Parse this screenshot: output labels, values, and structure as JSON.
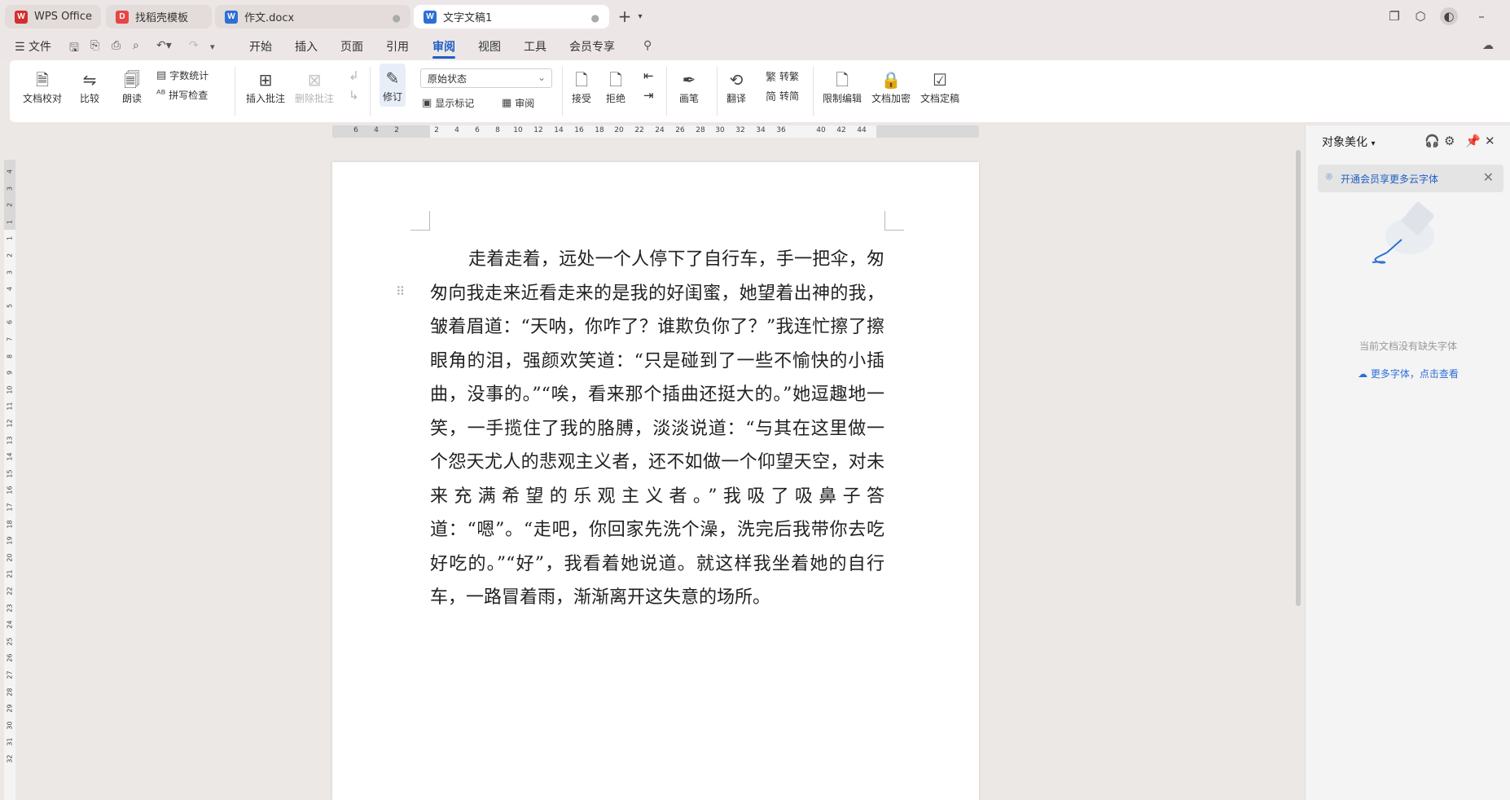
{
  "tabs": [
    {
      "label": "WPS Office",
      "icon": "wps-logo-icon",
      "icon_text": "W",
      "color": "#d42e2e"
    },
    {
      "label": "找稻壳模板",
      "icon": "docer-icon",
      "icon_text": "D",
      "color": "#e64545"
    },
    {
      "label": "作文.docx",
      "icon": "word-doc-icon",
      "icon_text": "W",
      "color": "#2e6fd6"
    },
    {
      "label": "文字文稿1",
      "icon": "word-doc-icon",
      "icon_text": "W",
      "color": "#2e6fd6"
    }
  ],
  "menu": {
    "file_label": "文件",
    "items": [
      "开始",
      "插入",
      "页面",
      "引用",
      "审阅",
      "视图",
      "工具",
      "会员专享"
    ],
    "active": "审阅"
  },
  "ribbon": {
    "proofread": "文档校对",
    "compare": "比较",
    "read_aloud": "朗读",
    "word_count": "字数统计",
    "spell_check": "拼写检查",
    "insert_comment": "插入批注",
    "delete_comment": "删除批注",
    "track_changes": "修订",
    "status_select": "原始状态",
    "show_markup": "显示标记",
    "review": "审阅",
    "accept": "接受",
    "reject": "拒绝",
    "pen": "画笔",
    "translate": "翻译",
    "to_traditional": "转繁",
    "to_simplified": "转简",
    "restrict_edit": "限制编辑",
    "encrypt": "文档加密",
    "finalize": "文档定稿"
  },
  "hruler_ticks": [
    "6",
    "4",
    "2",
    "2",
    "4",
    "6",
    "8",
    "10",
    "12",
    "14",
    "16",
    "18",
    "20",
    "22",
    "24",
    "26",
    "28",
    "30",
    "32",
    "34",
    "36",
    "40",
    "42",
    "44"
  ],
  "vruler_ticks": [
    "4",
    "3",
    "2",
    "1",
    "1",
    "2",
    "3",
    "4",
    "5",
    "6",
    "7",
    "8",
    "9",
    "10",
    "11",
    "12",
    "13",
    "14",
    "15",
    "16",
    "17",
    "18",
    "19",
    "20",
    "21",
    "22",
    "23",
    "24",
    "25",
    "26",
    "27",
    "28",
    "29",
    "30",
    "31",
    "32"
  ],
  "document": {
    "text": "走着走着，远处一个人停下了自行车，手一把伞，匆匆向我走来近看走来的是我的好闺蜜，她望着出神的我，皱着眉道：“天呐，你咋了？谁欺负你了？”我连忙擦了擦眼角的泪，强颜欢笑道：“只是碰到了一些不愉快的小插曲，没事的。”“唉，看来那个插曲还挺大的。”她逗趣地一笑，一手揽住了我的胳膊，淡淡说道：“与其在这里做一个怨天尤人的悲观主义者，还不如做一个仰望天空，对未来充满希望的乐观主义者。”我吸了吸鼻子答道：“嗯”。“走吧，你回家先洗个澡，洗完后我带你去吃好吃的。”“好”，我看着她说道。就这样我坐着她的自行车，一路冒着雨，渐渐离开这失意的场所。"
  },
  "side_panel": {
    "title": "对象美化",
    "promo": "开通会员享更多云字体",
    "empty_text": "当前文档没有缺失字体",
    "link": "更多字体，点击查看"
  }
}
